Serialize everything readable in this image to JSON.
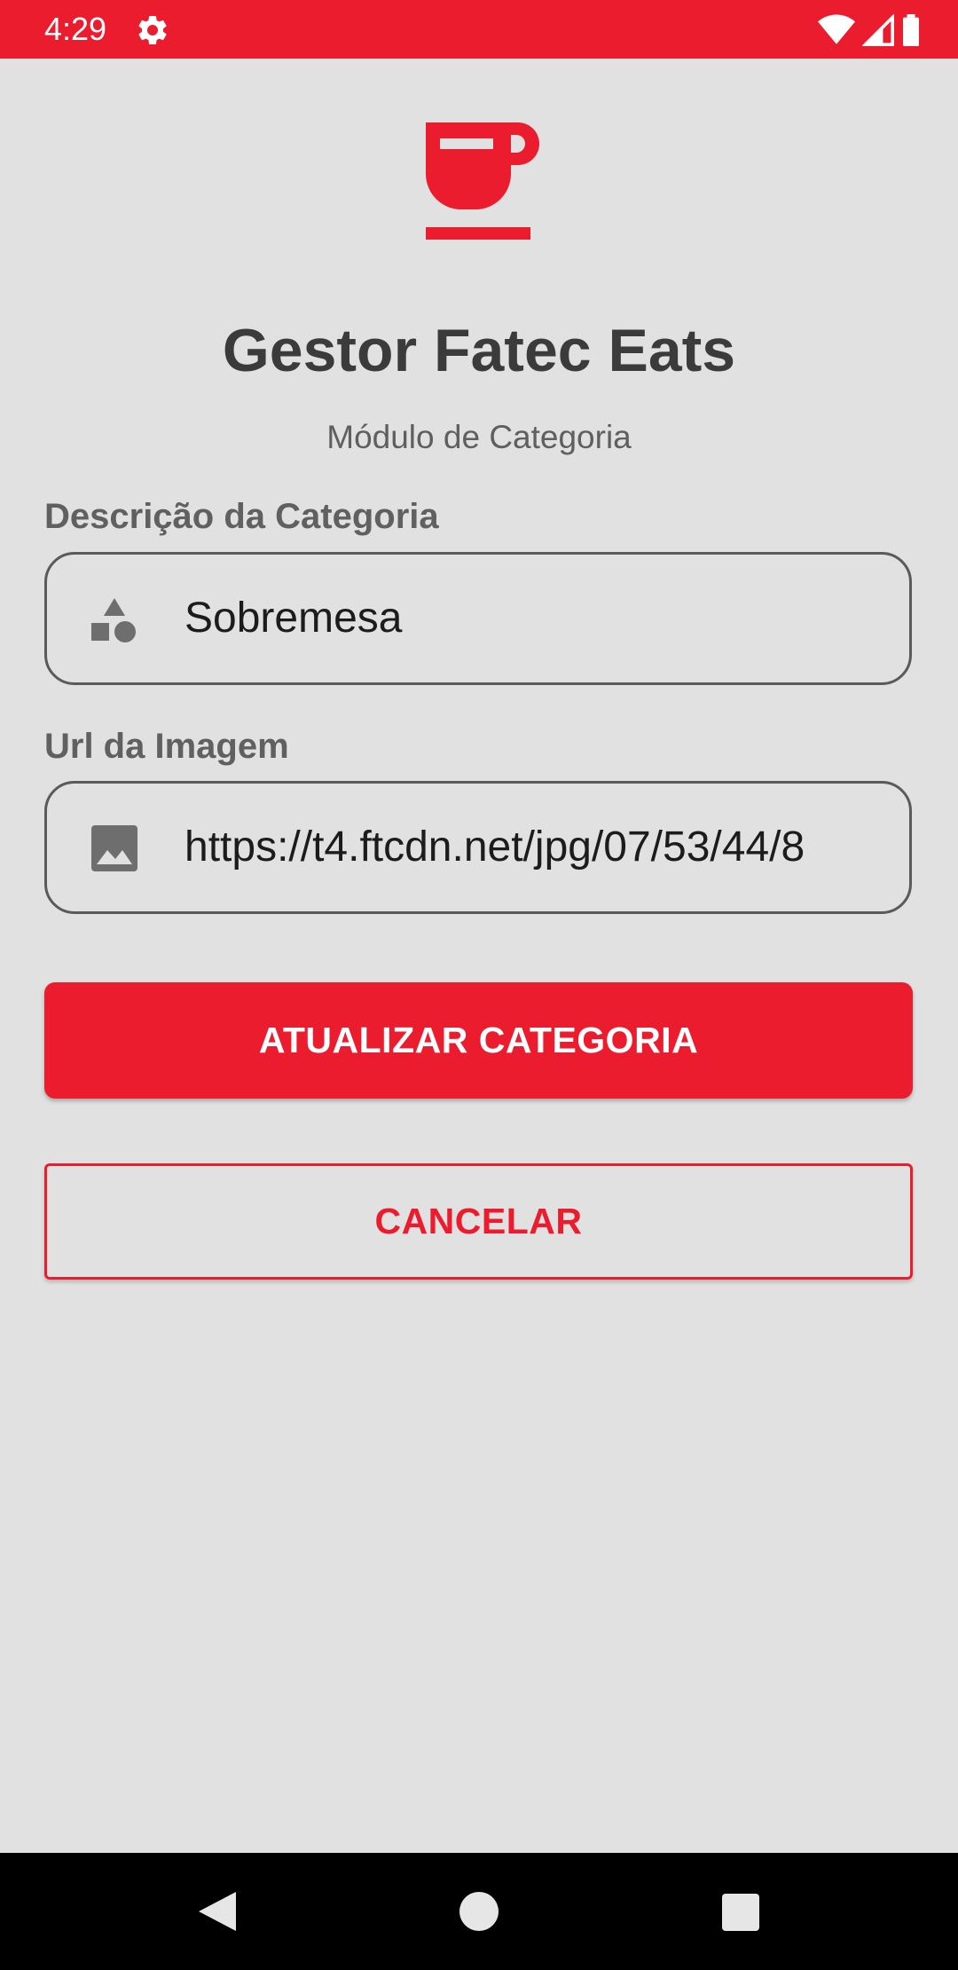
{
  "status_bar": {
    "time": "4:29",
    "icons": [
      "settings-gear-icon",
      "wifi-icon",
      "signal-icon",
      "battery-icon"
    ],
    "background_color": "#eb1c2d"
  },
  "header": {
    "logo_icon": "coffee-cup-icon",
    "title": "Gestor Fatec Eats",
    "subtitle": "Módulo de Categoria"
  },
  "form": {
    "description_field": {
      "label": "Descrição da Categoria",
      "value": "Sobremesa",
      "icon": "category-shapes-icon"
    },
    "image_url_field": {
      "label": "Url da Imagem",
      "value": "https://t4.ftcdn.net/jpg/07/53/44/8",
      "icon": "image-icon"
    }
  },
  "actions": {
    "update_label": "ATUALIZAR CATEGORIA",
    "cancel_label": "CANCELAR"
  },
  "nav_bar": {
    "icons": [
      "back-icon",
      "home-icon",
      "recents-icon"
    ]
  },
  "colors": {
    "accent": "#eb1c2d",
    "background": "#e1e1e1",
    "title_text": "#3b3b3b"
  }
}
